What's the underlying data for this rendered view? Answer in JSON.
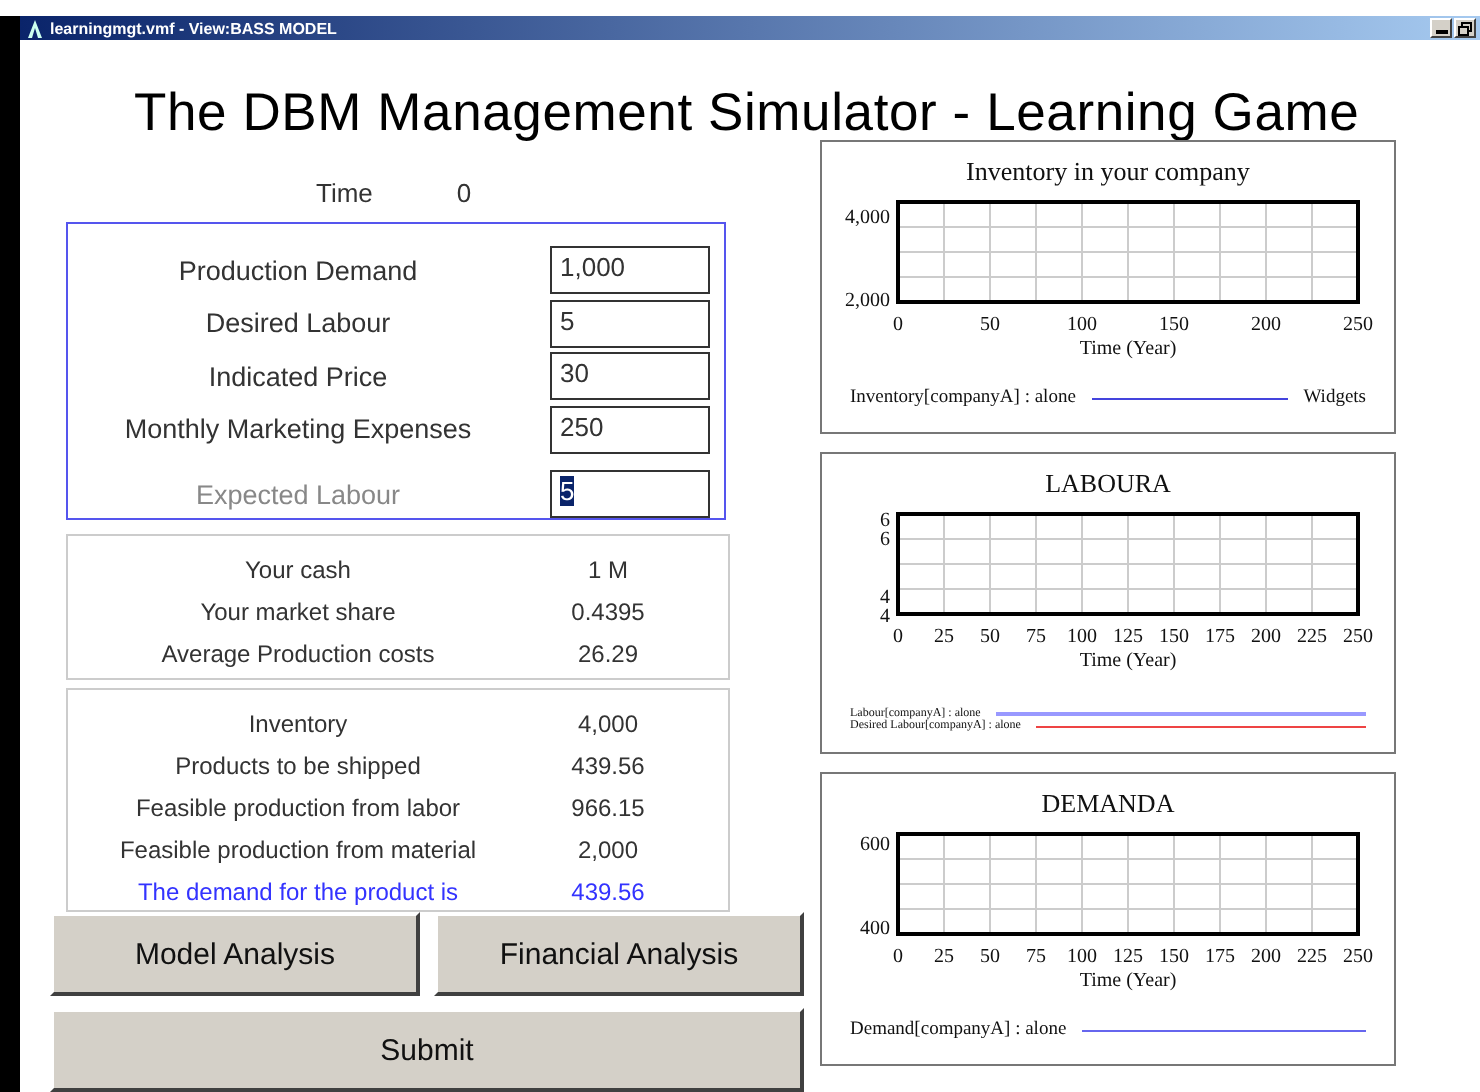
{
  "window": {
    "title": "learningmgt.vmf - View:BASS MODEL"
  },
  "title": "The DBM Management Simulator - Learning Game",
  "time": {
    "label": "Time",
    "value": "0"
  },
  "inputs": [
    {
      "label": "Production Demand",
      "value": "1,000",
      "disabled": false,
      "highlighted": false
    },
    {
      "label": "Desired Labour",
      "value": "5",
      "disabled": false,
      "highlighted": false
    },
    {
      "label": "Indicated Price",
      "value": "30",
      "disabled": false,
      "highlighted": false
    },
    {
      "label": "Monthly Marketing Expenses",
      "value": "250",
      "disabled": false,
      "highlighted": false
    },
    {
      "label": "Expected Labour",
      "value": "5",
      "disabled": true,
      "highlighted": true
    }
  ],
  "stats": [
    {
      "label": "Your cash",
      "value": "1 M"
    },
    {
      "label": "Your market share",
      "value": "0.4395"
    },
    {
      "label": "Average Production costs",
      "value": "26.29"
    }
  ],
  "details": [
    {
      "label": "Inventory",
      "value": "4,000",
      "color": "#333333"
    },
    {
      "label": "Products to be shipped",
      "value": "439.56",
      "color": "#333333"
    },
    {
      "label": "Feasible production from labor",
      "value": "966.15",
      "color": "#333333"
    },
    {
      "label": "Feasible production from material",
      "value": "2,000",
      "color": "#333333"
    },
    {
      "label": "The demand for the product is",
      "value": "439.56",
      "color": "#3333ff"
    }
  ],
  "buttons": [
    {
      "label": "Model Analysis"
    },
    {
      "label": "Financial Analysis"
    },
    {
      "label": "Submit"
    }
  ],
  "charts": [
    {
      "unit": "Widgets",
      "chart_data": {
        "type": "line",
        "title": "Inventory in your company",
        "grid": true,
        "xlabel": "Time (Year)",
        "ylim": [
          1900,
          4300
        ],
        "categories": [
          "0",
          "50",
          "100",
          "150",
          "200",
          "250"
        ],
        "yticks": [
          {
            "value": 4000,
            "label": "4,000"
          },
          {
            "value": 2000,
            "label": "2,000"
          }
        ],
        "series": [
          {
            "name": "Inventory[companyA] : alone",
            "color": "#4444dd",
            "values": [
              null,
              null,
              null,
              null,
              null,
              null
            ]
          }
        ]
      }
    },
    {
      "chart_data": {
        "type": "line",
        "title": "LABOURA",
        "grid": true,
        "xlabel": "Time (Year)",
        "ylim": [
          3.9,
          6.5
        ],
        "categories": [
          "0",
          "25",
          "50",
          "75",
          "100",
          "125",
          "150",
          "175",
          "200",
          "225",
          "250"
        ],
        "yticks": [
          {
            "value": 6.4,
            "label": "6"
          },
          {
            "value": 5.9,
            "label": "6"
          },
          {
            "value": 4.4,
            "label": "4"
          },
          {
            "value": 3.9,
            "label": "4"
          }
        ],
        "series": [
          {
            "name": "Labour[companyA] : alone",
            "color": "#9999ff",
            "values": [
              null,
              null,
              null,
              null,
              null,
              null,
              null,
              null,
              null,
              null,
              null
            ]
          },
          {
            "name": "Desired Labour[companyA] : alone",
            "color": "#ee4444",
            "values": [
              null,
              null,
              null,
              null,
              null,
              null,
              null,
              null,
              null,
              null,
              null
            ]
          }
        ]
      }
    },
    {
      "chart_data": {
        "type": "line",
        "title": "DEMANDA",
        "grid": true,
        "xlabel": "Time (Year)",
        "ylim": [
          380,
          620
        ],
        "categories": [
          "0",
          "25",
          "50",
          "75",
          "100",
          "125",
          "150",
          "175",
          "200",
          "225",
          "250"
        ],
        "yticks": [
          {
            "value": 600,
            "label": "600"
          },
          {
            "value": 400,
            "label": "400"
          }
        ],
        "series": [
          {
            "name": "Demand[companyA] : alone",
            "color": "#6666ee",
            "values": [
              null,
              null,
              null,
              null,
              null,
              null,
              null,
              null,
              null,
              null,
              null
            ]
          }
        ]
      }
    }
  ]
}
